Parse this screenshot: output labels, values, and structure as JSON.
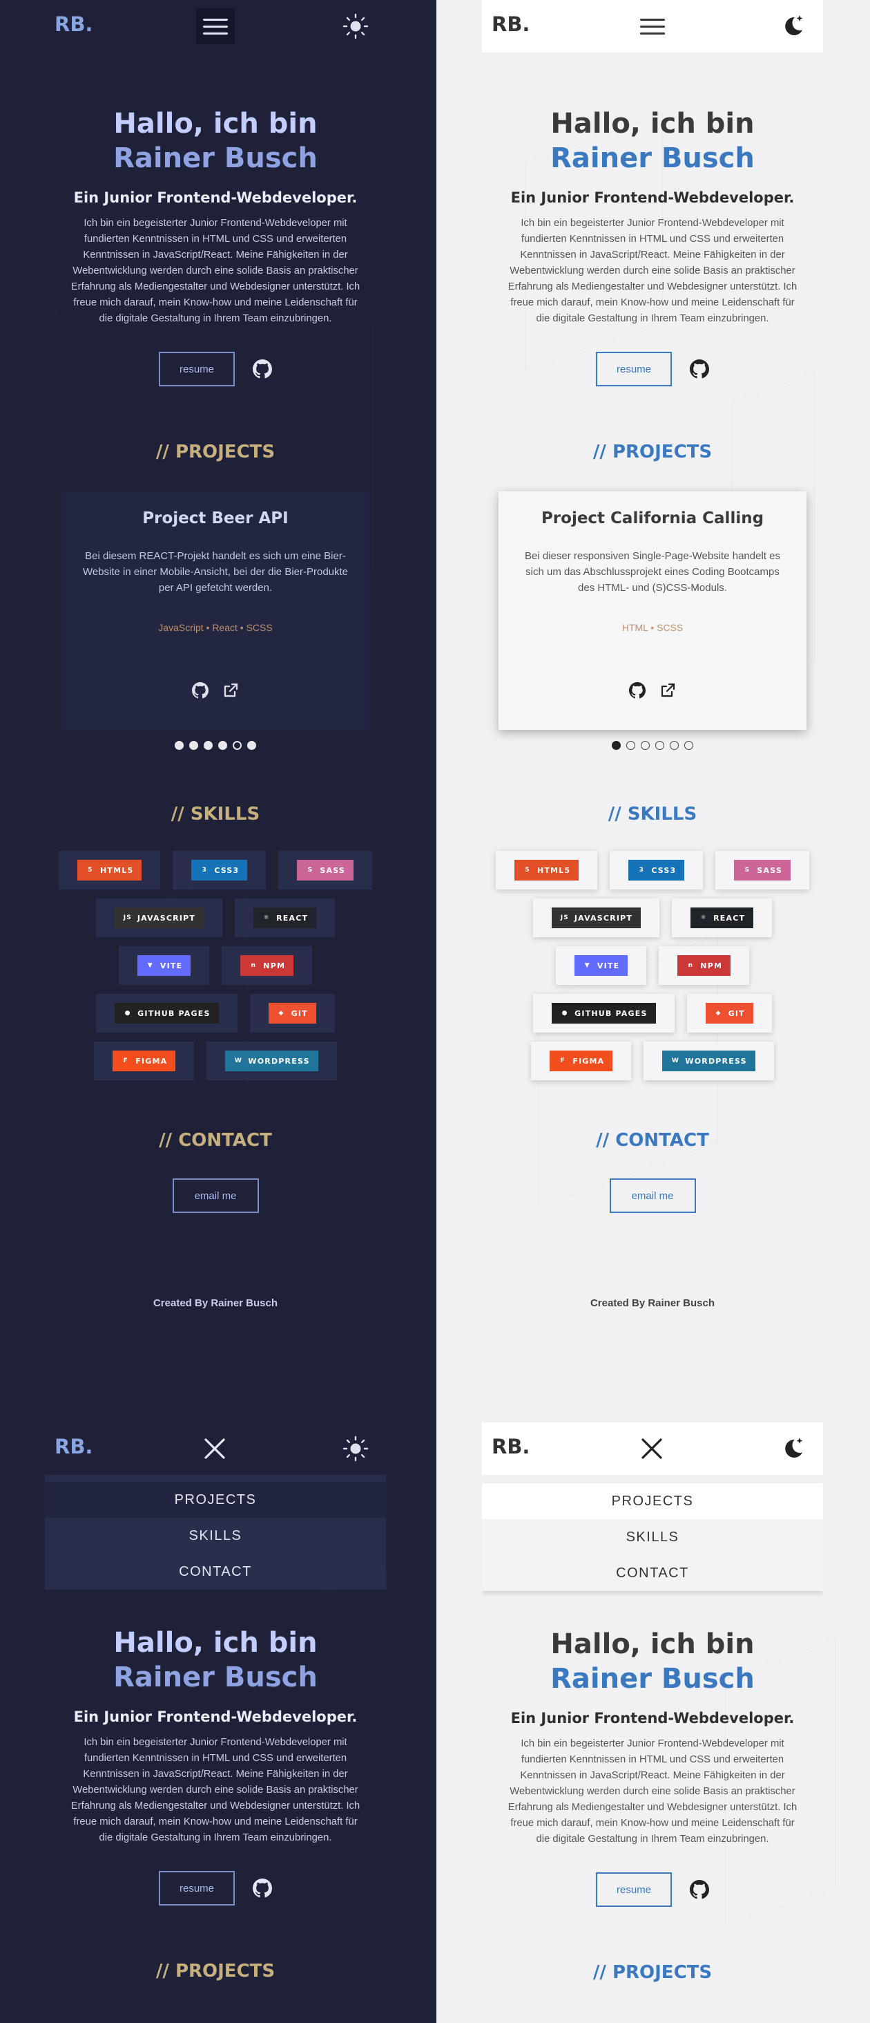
{
  "logo": "RB.",
  "hero": {
    "line1": "Hallo, ich bin",
    "line2": "Rainer Busch",
    "subtitle": "Ein Junior Frontend-Webdeveloper.",
    "bio": "Ich bin ein begeisterter Junior Frontend-Webdeveloper mit fundierten Kenntnissen in HTML und CSS und erweiterten Kenntnissen in JavaScript/React. Meine Fähigkeiten in der Webentwicklung werden durch eine solide Basis an praktischer Erfahrung als Mediengestalter und Webdesigner unterstützt. Ich freue mich darauf, mein Know-how und meine Leidenschaft für die digitale Gestaltung in Ihrem Team einzubringen.",
    "resume_label": "resume"
  },
  "sections": {
    "projects": "PROJECTS",
    "skills": "SKILLS",
    "contact": "CONTACT",
    "slashes": "//"
  },
  "projects_dark": {
    "title": "Project Beer API",
    "description": "Bei diesem REACT-Projekt handelt es sich um eine Bier-Website in einer Mobile-Ansicht, bei der die Bier-Produkte per API gefetcht werden.",
    "tech": "JavaScript • React • SCSS",
    "active_dot": 4
  },
  "projects_light": {
    "title": "Project California Calling",
    "description": "Bei dieser responsiven Single-Page-Website handelt es sich um das Abschlussprojekt eines Coding Bootcamps des HTML- und (S)CSS-Moduls.",
    "tech": "HTML • SCSS",
    "active_dot": 0
  },
  "skills": [
    {
      "label": "HTML5",
      "color": "#e34f26",
      "icon": "html5-icon",
      "glyph": "5"
    },
    {
      "label": "CSS3",
      "color": "#1572b6",
      "icon": "css3-icon",
      "glyph": "3"
    },
    {
      "label": "SASS",
      "color": "#cc6699",
      "icon": "sass-icon",
      "glyph": "S"
    },
    {
      "label": "JAVASCRIPT",
      "color": "#323330",
      "icon": "javascript-icon",
      "glyph": "JS"
    },
    {
      "label": "REACT",
      "color": "#20232a",
      "icon": "react-icon",
      "glyph": "⚛"
    },
    {
      "label": "VITE",
      "color": "#646cff",
      "icon": "vite-icon",
      "glyph": "▼"
    },
    {
      "label": "NPM",
      "color": "#cb3837",
      "icon": "npm-icon",
      "glyph": "n"
    },
    {
      "label": "GITHUB PAGES",
      "color": "#222222",
      "icon": "github-icon",
      "glyph": "●"
    },
    {
      "label": "GIT",
      "color": "#f05032",
      "icon": "git-icon",
      "glyph": "◆"
    },
    {
      "label": "FIGMA",
      "color": "#f24e1e",
      "icon": "figma-icon",
      "glyph": "F"
    },
    {
      "label": "WORDPRESS",
      "color": "#21759b",
      "icon": "wordpress-icon",
      "glyph": "W"
    }
  ],
  "contact": {
    "email_label": "email me"
  },
  "footer": "Created By Rainer Busch",
  "nav": [
    "PROJECTS",
    "SKILLS",
    "CONTACT"
  ],
  "colors": {
    "dark_bg": "#1e2138",
    "light_bg": "#f1f1f3",
    "dark_accent": "#c8b07e",
    "light_accent": "#3a78c0"
  }
}
